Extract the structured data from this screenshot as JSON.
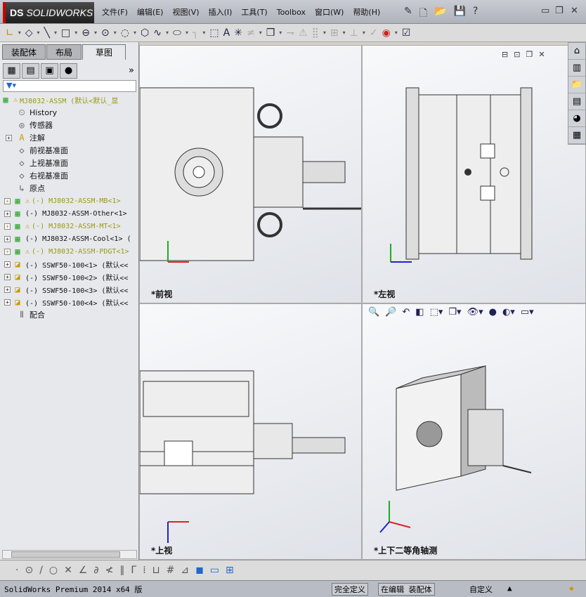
{
  "app": {
    "logo": "SOLIDWORKS",
    "logo_prefix": "DS"
  },
  "menu": [
    "文件(F)",
    "编辑(E)",
    "视图(V)",
    "插入(I)",
    "工具(T)",
    "Toolbox",
    "窗口(W)",
    "帮助(H)"
  ],
  "left_panel": {
    "tabs": [
      "装配体",
      "布局",
      "草图"
    ],
    "active_tab": "草图",
    "tree": [
      {
        "label": "MJ8032-ASSM  (默认<默认_显",
        "icon": "assembly-icon",
        "warn": true,
        "expand": false
      },
      {
        "label": "History",
        "icon": "history-icon",
        "warn": false,
        "expand": false
      },
      {
        "label": "传感器",
        "icon": "sensor-icon",
        "warn": false,
        "expand": false
      },
      {
        "label": "注解",
        "icon": "annotation-icon",
        "warn": false,
        "expand": true
      },
      {
        "label": "前视基准面",
        "icon": "plane-icon",
        "warn": false,
        "expand": false
      },
      {
        "label": "上视基准面",
        "icon": "plane-icon",
        "warn": false,
        "expand": false
      },
      {
        "label": "右视基准面",
        "icon": "plane-icon",
        "warn": false,
        "expand": false
      },
      {
        "label": "原点",
        "icon": "origin-icon",
        "warn": false,
        "expand": false
      },
      {
        "label": "(-) MJ8032-ASSM-MB<1>",
        "icon": "assembly-icon",
        "warn": true,
        "expand": true
      },
      {
        "label": "(-) MJ8032-ASSM-Other<1>",
        "icon": "assembly-icon",
        "warn": false,
        "expand": true
      },
      {
        "label": "(-) MJ8032-ASSM-MT<1>",
        "icon": "assembly-icon",
        "warn": true,
        "expand": true
      },
      {
        "label": "(-) MJ8032-ASSM-Cool<1> (",
        "icon": "assembly-icon",
        "warn": false,
        "expand": true
      },
      {
        "label": "(-) MJ8032-ASSM-PDGT<1>",
        "icon": "assembly-icon",
        "warn": true,
        "expand": true
      },
      {
        "label": "(-) SSWF50-100<1> (默认<<",
        "icon": "part-icon",
        "warn": false,
        "expand": true
      },
      {
        "label": "(-) SSWF50-100<2> (默认<<",
        "icon": "part-icon",
        "warn": false,
        "expand": true
      },
      {
        "label": "(-) SSWF50-100<3> (默认<<",
        "icon": "part-icon",
        "warn": false,
        "expand": true
      },
      {
        "label": "(-) SSWF50-100<4> (默认<<",
        "icon": "part-icon",
        "warn": false,
        "expand": true
      },
      {
        "label": "配合",
        "icon": "mates-icon",
        "warn": false,
        "expand": false
      }
    ]
  },
  "viewports": {
    "front": "*前视",
    "left": "*左视",
    "top": "*上视",
    "iso": "*上下二等角轴测"
  },
  "status": {
    "product": "SolidWorks Premium 2014 x64 版",
    "defined": "完全定义",
    "editing": "在编辑 装配体",
    "units": "自定义"
  },
  "colors": {
    "warn": "#9a9a10",
    "axis_x": "#d22",
    "axis_y": "#2a2",
    "axis_z": "#22c"
  }
}
